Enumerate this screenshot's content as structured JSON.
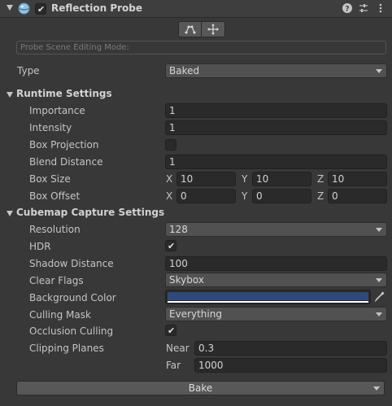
{
  "header": {
    "title": "Reflection Probe",
    "enabled": true,
    "icons": [
      "help-icon",
      "preset-icon",
      "more-options-icon"
    ]
  },
  "toolbar": {
    "tools": [
      "edit-bounds-icon",
      "move-origin-icon"
    ]
  },
  "editing_mode": {
    "label": "Probe Scene Editing Mode:"
  },
  "type": {
    "label": "Type",
    "value": "Baked"
  },
  "runtime": {
    "title": "Runtime Settings",
    "importance": {
      "label": "Importance",
      "value": "1"
    },
    "intensity": {
      "label": "Intensity",
      "value": "1"
    },
    "box_projection": {
      "label": "Box Projection",
      "checked": false
    },
    "blend_distance": {
      "label": "Blend Distance",
      "value": "1"
    },
    "box_size": {
      "label": "Box Size",
      "x": "10",
      "y": "10",
      "z": "10"
    },
    "box_offset": {
      "label": "Box Offset",
      "x": "0",
      "y": "0",
      "z": "0"
    },
    "axis": {
      "x": "X",
      "y": "Y",
      "z": "Z"
    }
  },
  "cubemap": {
    "title": "Cubemap Capture Settings",
    "resolution": {
      "label": "Resolution",
      "value": "128"
    },
    "hdr": {
      "label": "HDR",
      "checked": true
    },
    "shadow_distance": {
      "label": "Shadow Distance",
      "value": "100"
    },
    "clear_flags": {
      "label": "Clear Flags",
      "value": "Skybox"
    },
    "background_color": {
      "label": "Background Color",
      "color": "#2e4a7a"
    },
    "culling_mask": {
      "label": "Culling Mask",
      "value": "Everything"
    },
    "occlusion_culling": {
      "label": "Occlusion Culling",
      "checked": true
    },
    "clipping_planes": {
      "label": "Clipping Planes",
      "near_label": "Near",
      "near": "0.3",
      "far_label": "Far",
      "far": "1000"
    }
  },
  "bake": {
    "label": "Bake"
  }
}
